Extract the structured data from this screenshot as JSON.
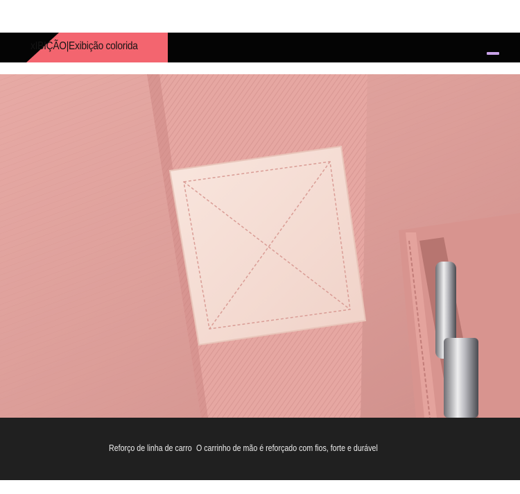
{
  "header": {
    "title": "xIBIÇÃO|Exibição colorida",
    "accent_color": "#f3656f",
    "mark_color": "#c9a2e8"
  },
  "photo": {
    "subject": "pink fabric bag with reinforced strap patch and zipper",
    "fabric_color": "#dfa19c",
    "strap_color": "#e8a9a4",
    "patch_color": "#f6dcd3"
  },
  "caption": {
    "part1": "Reforço de linha de carro",
    "part2": "O carrinho de mão é reforçado com fios, forte e durável"
  }
}
